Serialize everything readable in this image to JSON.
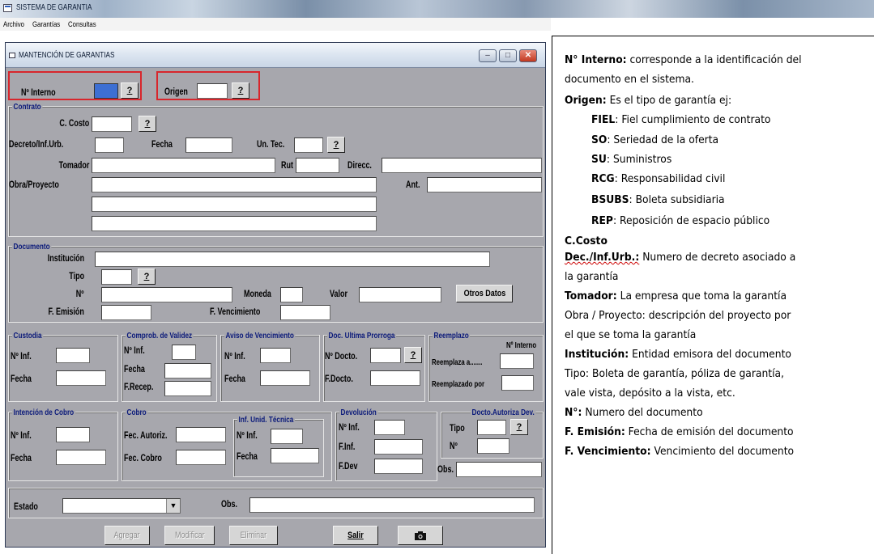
{
  "app": {
    "title": "SISTEMA DE GARANTIA"
  },
  "menu": [
    "Archivo",
    "Garantías",
    "Consultas"
  ],
  "window": {
    "title": "MANTENCIÓN DE GARANTIAS",
    "controls": [
      "minimize-icon",
      "maximize-icon",
      "close-icon"
    ]
  },
  "header": {
    "interno_label": "Nº Interno",
    "origen_label": "Origen",
    "help": "?"
  },
  "contrato": {
    "title": "Contrato",
    "c_costo": "C. Costo",
    "decreto": "Decreto/Inf.Urb.",
    "fecha": "Fecha",
    "un_tec": "Un. Tec.",
    "tomador": "Tomador",
    "rut": "Rut",
    "direcc": "Direcc.",
    "obra": "Obra/Proyecto",
    "ant": "Ant."
  },
  "documento": {
    "title": "Documento",
    "institucion": "Institución",
    "tipo": "Tipo",
    "no": "Nº",
    "moneda": "Moneda",
    "valor": "Valor",
    "otros": "Otros Datos",
    "f_emision": "F. Emisión",
    "f_venc": "F. Vencimiento"
  },
  "custodia": {
    "title": "Custodia",
    "inf": "Nº Inf.",
    "fecha": "Fecha"
  },
  "comprob": {
    "title": "Comprob. de Validez",
    "inf": "Nº Inf.",
    "fecha": "Fecha",
    "recep": "F.Recep."
  },
  "aviso": {
    "title": "Aviso de Vencimiento",
    "inf": "Nº Inf.",
    "fecha": "Fecha"
  },
  "prorroga": {
    "title": "Doc. Ultima Prorroga",
    "docto": "Nº Docto.",
    "fdocto": "F.Docto."
  },
  "reemplazo": {
    "title": "Reemplazo",
    "interno": "Nº Interno",
    "reemplaza": "Reemplaza a.......",
    "reemplazado": "Reemplazado por"
  },
  "intencion": {
    "title": "Intención de Cobro",
    "inf": "Nº Inf.",
    "fecha": "Fecha"
  },
  "cobro": {
    "title": "Cobro",
    "autoriz": "Fec. Autoriz.",
    "fcobro": "Fec. Cobro"
  },
  "inf_unid": {
    "title": "Inf. Unid. Técnica",
    "inf": "Nº Inf.",
    "fecha": "Fecha"
  },
  "devolucion": {
    "title": "Devolución",
    "inf": "Nº Inf.",
    "finf": "F.Inf.",
    "fdev": "F.Dev"
  },
  "docto_autoriza": {
    "title": "Docto.Autoriza Dev.",
    "tipo": "Tipo",
    "no": "Nº",
    "obs": "Obs."
  },
  "estado": {
    "label": "Estado",
    "obs": "Obs.",
    "dropdown_icon": "chevron-down-icon"
  },
  "buttons": {
    "agregar": "Agregar",
    "modificar": "Modificar",
    "eliminar": "Eliminar",
    "salir": "Salir",
    "camera_icon": "camera-icon"
  },
  "notes": [
    {
      "b": "N° Interno:",
      "t": " corresponde a la identificación del"
    },
    {
      "b": "",
      "t": "documento en el sistema."
    },
    {
      "b": "Origen:",
      "t": " Es el tipo de garantía ej:"
    },
    {
      "b": "FIEL",
      "t": ": Fiel cumplimiento de contrato"
    },
    {
      "b": "SO",
      "t": ": Seriedad de la oferta"
    },
    {
      "b": "SU",
      "t": ": Suministros"
    },
    {
      "b": "RCG",
      "t": ": Responsabilidad civil"
    },
    {
      "b": "BSUBS",
      "t": ":  Boleta subsidiaria"
    },
    {
      "b": "REP",
      "t": ":  Reposición de espacio público"
    },
    {
      "b": "C.Costo",
      "t": ""
    },
    {
      "b": "Dec./Inf.Urb.:",
      "t": " Numero de decreto asociado a"
    },
    {
      "b": "",
      "t": "la  garantía"
    },
    {
      "b": "Tomador:",
      "t": " La empresa que toma la garantía"
    },
    {
      "b": "",
      "t": "Obra / Proyecto: descripción del proyecto por"
    },
    {
      "b": "",
      "t": "el que se toma la garantía"
    },
    {
      "b": "Institución:",
      "t": " Entidad emisora del documento"
    },
    {
      "b": "",
      "t": "Tipo: Boleta de garantía, póliza de garantía,"
    },
    {
      "b": "",
      "t": "vale vista, depósito a la vista, etc."
    },
    {
      "b": "N°:",
      "t": " Numero del documento"
    },
    {
      "b": "F. Emisión:",
      "t": " Fecha de emisión del documento"
    },
    {
      "b": "F. Vencimiento:",
      "t": " Vencimiento del documento"
    }
  ],
  "colors": {
    "form_bg": "#a7a7ad",
    "group_title": "#0b1a7a",
    "highlight": "#d8262c"
  }
}
